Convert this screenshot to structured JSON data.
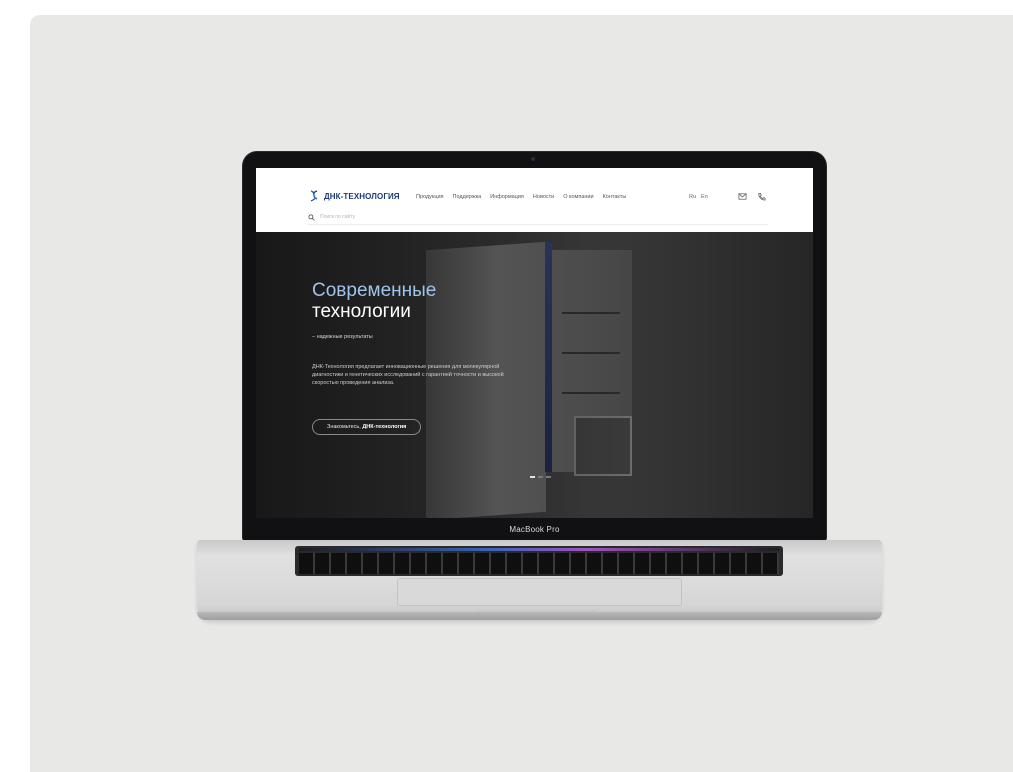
{
  "device": {
    "label": "MacBook Pro"
  },
  "site": {
    "logo_text": "ДНК-ТЕХНОЛОГИЯ",
    "nav": [
      {
        "label": "Продукция"
      },
      {
        "label": "Поддержка"
      },
      {
        "label": "Информация"
      },
      {
        "label": "Новости"
      },
      {
        "label": "О компании"
      },
      {
        "label": "Контакты"
      }
    ],
    "languages": [
      "Ru",
      "En"
    ],
    "search": {
      "placeholder": "Поиск по сайту"
    },
    "hero": {
      "title_accent": "Современные",
      "title_main": "технологии",
      "subtitle": "– надежные результаты",
      "description": "ДНК-Технология предлагает инновационные решения для молекулярной диагностики и генетических исследований с гарантией точности и высокой скоростью проведения анализа.",
      "cta_prefix": "Знакомьтесь,",
      "cta_brand": "ДНК-технология",
      "slides_total": 3,
      "slide_active": 1
    },
    "colors": {
      "brand": "#1c3a7a",
      "accent": "#9fc3ea"
    }
  }
}
